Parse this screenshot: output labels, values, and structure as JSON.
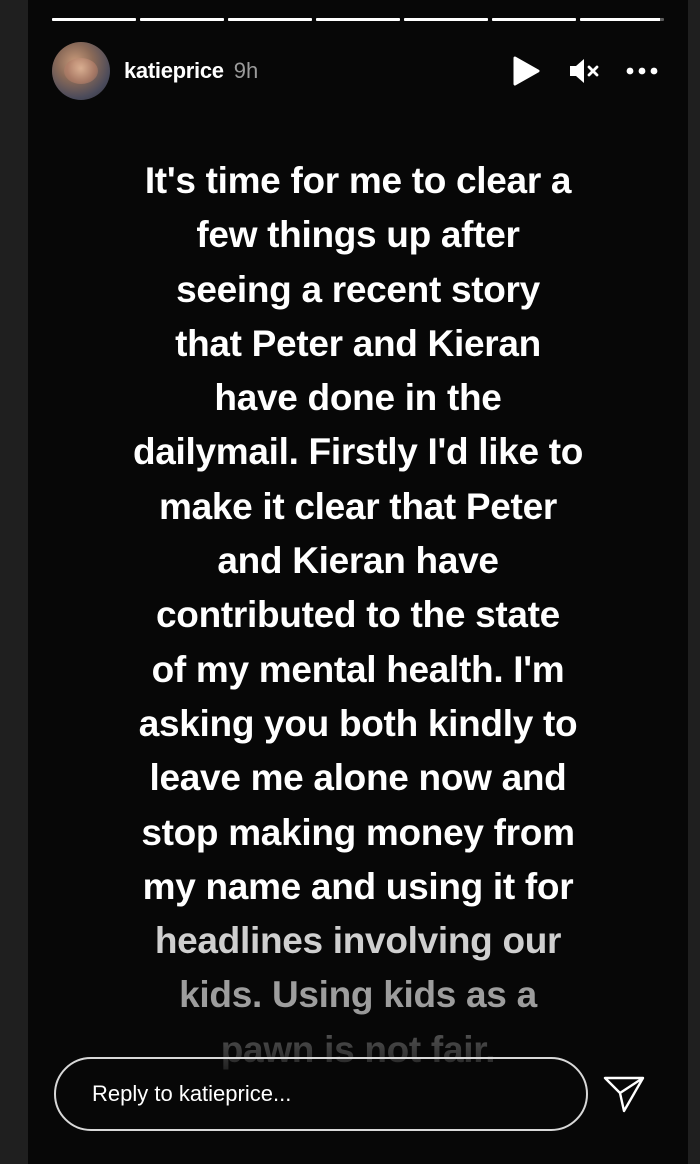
{
  "story": {
    "username": "katieprice",
    "time_ago": "9h",
    "progress_segments": [
      1,
      1,
      1,
      1,
      1,
      1,
      0.95
    ],
    "caption_lines": [
      "It's time for me to clear a",
      "few things up after",
      "seeing a recent story",
      "that Peter and Kieran",
      "have done in the",
      "dailymail. Firstly I'd like to",
      "make it clear that Peter",
      "and Kieran have",
      "contributed to the state",
      "of my mental health. I'm",
      "asking you both kindly to",
      "leave me alone now and",
      "stop making money from",
      "my name and using it for",
      "headlines involving our",
      "kids.  Using kids as a",
      "pawn is not fair."
    ]
  },
  "header": {
    "play_icon": "play-icon",
    "mute_icon": "mute-icon",
    "more_icon": "more-icon"
  },
  "reply": {
    "placeholder": "Reply to katieprice...",
    "send_icon": "send-icon"
  },
  "colors": {
    "background": "#070707",
    "text": "#ffffff",
    "muted": "#9a9a9a",
    "input_border": "#d8d8d8"
  }
}
